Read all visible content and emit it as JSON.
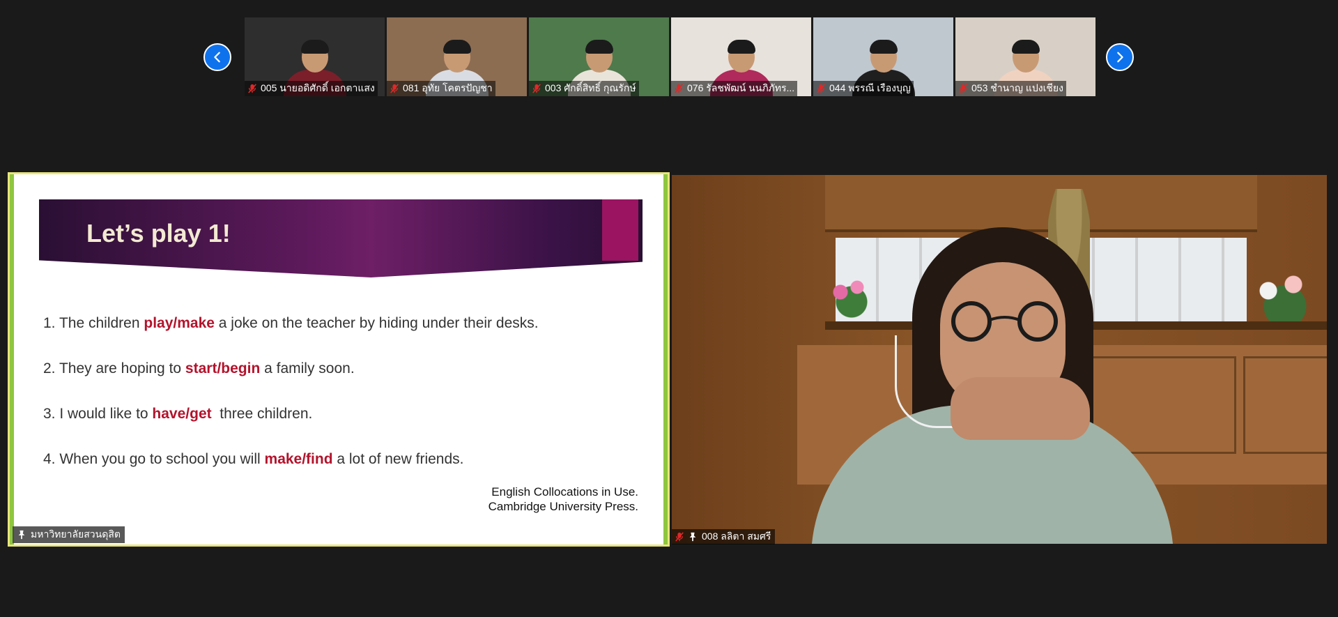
{
  "gallery": {
    "participants": [
      {
        "name": "005 นายอดิศักดิ์ เอกตาแสง",
        "torso": "#7b1f2a",
        "bg": "#2e2e2e"
      },
      {
        "name": "081 อุทัย โคตรปัญชา",
        "torso": "#d9dde3",
        "bg": "#8c6d52"
      },
      {
        "name": "003 ศักดิ์สิทธิ์ กุณรักษ์",
        "torso": "#e9e4da",
        "bg": "#4f7a4c"
      },
      {
        "name": "076 รัลชพัฒน์ นนภิภัทร...",
        "torso": "#b02a5b",
        "bg": "#e7e2dc"
      },
      {
        "name": "044 พรรณี เรืองบุญ",
        "torso": "#1f1f1f",
        "bg": "#bfc7cf"
      },
      {
        "name": "053 ชำนาญ แปงเชียง",
        "torso": "#f0d2c0",
        "bg": "#d8d0c6"
      }
    ]
  },
  "slide": {
    "title": "Let’s play 1!",
    "items": [
      {
        "before": "1. The children ",
        "highlight": "play/make",
        "after": " a joke on the teacher by hiding under their desks."
      },
      {
        "before": "2. They are hoping to ",
        "highlight": "start/begin",
        "after": " a family soon."
      },
      {
        "before": "3. I would like to ",
        "highlight": "have/get",
        "after": "  three children."
      },
      {
        "before": "4. When you go to school you will ",
        "highlight": "make/find",
        "after": " a lot of new friends."
      }
    ],
    "citation_line1": "English Collocations in Use.",
    "citation_line2": "Cambridge University Press.",
    "sharer_label": "มหาวิทยาลัยสวนดุสิต"
  },
  "speaker": {
    "label": "008 ลลิตา  สมศรี"
  },
  "colors": {
    "accent_blue": "#0e72ed",
    "highlight_red": "#b3132c",
    "share_border": "#e8e67c",
    "mic_muted_red": "#e02828"
  },
  "icons": {
    "prev": "chevron-left-icon",
    "next": "chevron-right-icon",
    "mic_muted": "mic-muted-icon",
    "pin": "pin-icon"
  }
}
